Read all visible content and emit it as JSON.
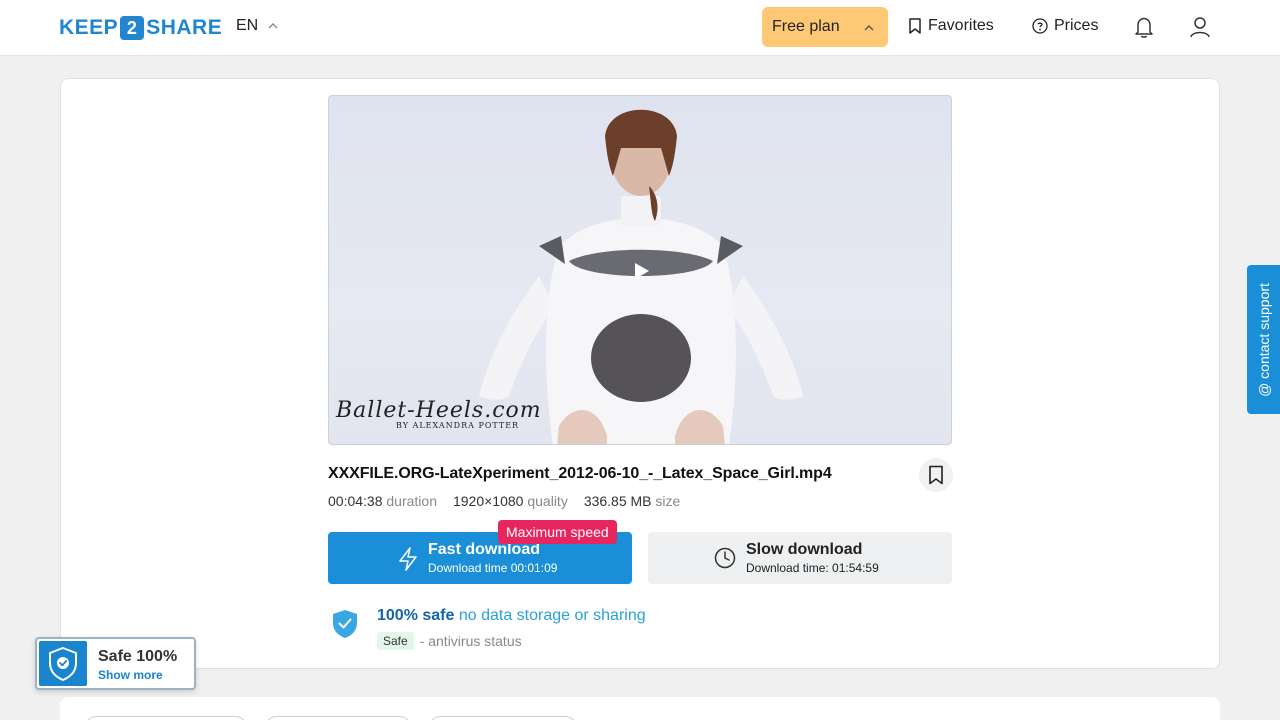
{
  "header": {
    "logo_left": "KEEP",
    "logo_mid": "2",
    "logo_right": "SHARE",
    "language": "EN",
    "plan_label": "Free plan",
    "favorites_label": "Favorites",
    "prices_label": "Prices"
  },
  "video": {
    "watermark_brand": "Ballet-Heels.com",
    "watermark_sub": "BY ALEXANDRA POTTER"
  },
  "file": {
    "name": "XXXFILE.ORG-LateXperiment_2012-06-10_-_Latex_Space_Girl.mp4",
    "duration_value": "00:04:38",
    "duration_label": "duration",
    "quality_value": "1920×1080",
    "quality_label": "quality",
    "size_value": "336.85 MB",
    "size_label": "size"
  },
  "download": {
    "badge": "Maximum speed",
    "fast_title": "Fast download",
    "fast_time": "Download time 00:01:09",
    "slow_title": "Slow download",
    "slow_time": "Download time: 01:54:59"
  },
  "safety": {
    "strong": "100% safe",
    "light": "no data storage or sharing",
    "tag": "Safe",
    "status": "- antivirus status"
  },
  "safe_badge": {
    "title": "Safe 100%",
    "link": "Show more"
  },
  "contact": {
    "label": "@ contact support"
  },
  "colors": {
    "brand": "#2186cf",
    "fast_button": "#1a8fd8",
    "badge": "#e8265e",
    "plan": "#ffc875"
  }
}
